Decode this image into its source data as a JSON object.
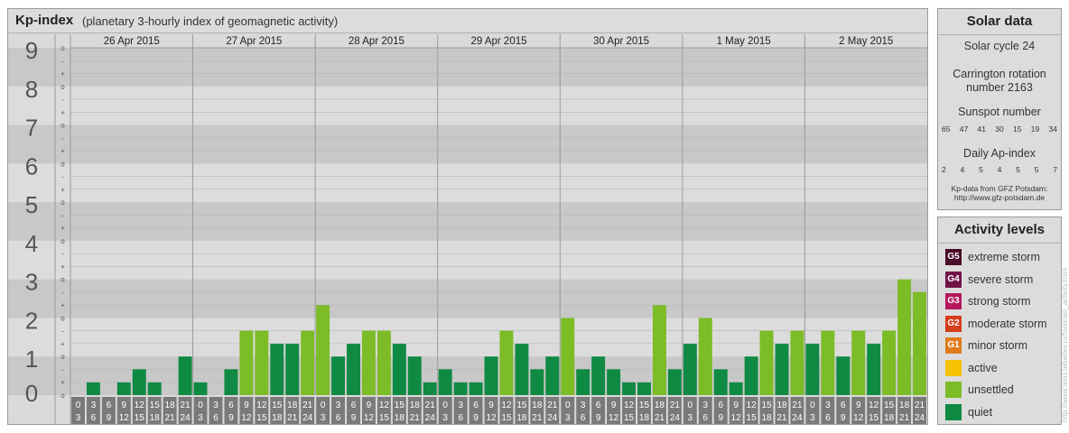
{
  "header": {
    "title": "Kp-index",
    "subtitle": "(planetary 3-hourly index of geomagnetic activity)"
  },
  "chart_data": {
    "type": "bar",
    "y_levels": [
      "0",
      "1",
      "2",
      "3",
      "4",
      "5",
      "6",
      "7",
      "8",
      "9"
    ],
    "y_minor_labels": [
      "o",
      "-",
      "+"
    ],
    "ylim": [
      0,
      9
    ],
    "days": [
      "26 Apr 2015",
      "27 Apr 2015",
      "28 Apr 2015",
      "29 Apr 2015",
      "30 Apr 2015",
      "1 May 2015",
      "2 May 2015"
    ],
    "hour_starts": [
      "0",
      "3",
      "6",
      "9",
      "12",
      "15",
      "18",
      "21"
    ],
    "hour_ends": [
      "3",
      "6",
      "9",
      "12",
      "15",
      "18",
      "21",
      "24"
    ],
    "values": [
      0.0,
      0.33,
      0.0,
      0.33,
      0.67,
      0.33,
      0.0,
      1.0,
      0.33,
      0.0,
      0.67,
      1.67,
      1.67,
      1.33,
      1.33,
      1.67,
      2.33,
      1.0,
      1.33,
      1.67,
      1.67,
      1.33,
      1.0,
      0.33,
      0.67,
      0.33,
      0.33,
      1.0,
      1.67,
      1.33,
      0.67,
      1.0,
      2.0,
      0.67,
      1.0,
      0.67,
      0.33,
      0.33,
      2.33,
      0.67,
      1.33,
      2.0,
      0.67,
      0.33,
      1.0,
      1.67,
      1.33,
      1.67,
      1.33,
      1.67,
      1.0,
      1.67,
      1.33,
      1.67,
      3.0,
      2.67
    ],
    "colors": {
      "quiet": "#0f8a43",
      "unsettled": "#7cbc27",
      "active": "#f4c200",
      "minor": "#e07a1c",
      "moderate": "#d63d1c",
      "strong": "#b5175f",
      "severe": "#731447",
      "extreme": "#4a0a2a"
    },
    "grid": true
  },
  "solar": {
    "title": "Solar data",
    "cycle_text": "Solar cycle 24",
    "carrington_line1": "Carrington rotation",
    "carrington_line2": "number 2163",
    "sunspot_title": "Sunspot number",
    "sunspot_values": [
      "65",
      "47",
      "41",
      "30",
      "15",
      "19",
      "34"
    ],
    "ap_title": "Daily Ap-index",
    "ap_values": [
      "2",
      "4",
      "5",
      "4",
      "5",
      "5",
      "7"
    ],
    "source_line1": "Kp-data from GFZ Potsdam:",
    "source_line2": "http://www.gfz-potsdam.de"
  },
  "levels": {
    "title": "Activity levels",
    "items": [
      {
        "badge": "G5",
        "label": "extreme storm",
        "color": "#4a0a2a"
      },
      {
        "badge": "G4",
        "label": "severe storm",
        "color": "#731447"
      },
      {
        "badge": "G3",
        "label": "strong storm",
        "color": "#b5175f"
      },
      {
        "badge": "G2",
        "label": "moderate storm",
        "color": "#d63d1c"
      },
      {
        "badge": "G1",
        "label": "minor storm",
        "color": "#e07a1c"
      },
      {
        "badge": "",
        "label": "active",
        "color": "#f4c200"
      },
      {
        "badge": "",
        "label": "unsettled",
        "color": "#7cbc27"
      },
      {
        "badge": "",
        "label": "quiet",
        "color": "#0f8a43"
      }
    ]
  },
  "credit": "http://www.tesis.lebedev.ru/forecast_activity.html"
}
